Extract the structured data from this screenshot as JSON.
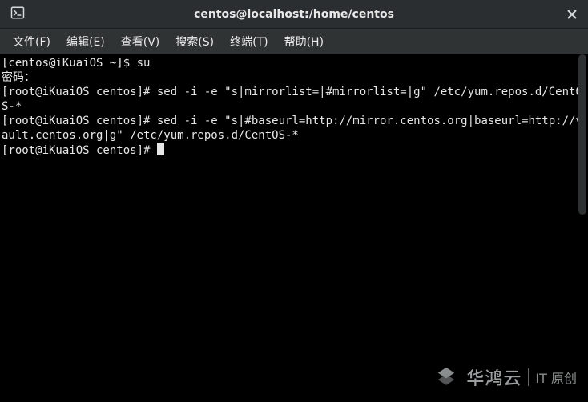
{
  "window": {
    "title": "centos@localhost:/home/centos"
  },
  "menu": {
    "file": "文件(F)",
    "edit": "编辑(E)",
    "view": "查看(V)",
    "search": "搜索(S)",
    "terminal": "终端(T)",
    "help": "帮助(H)"
  },
  "terminal": {
    "line1": "[centos@iKuaiOS ~]$ su",
    "line2": "密码：",
    "line3": "[root@iKuaiOS centos]# sed -i -e \"s|mirrorlist=|#mirrorlist=|g\" /etc/yum.repos.d/CentOS-*",
    "line4": "[root@iKuaiOS centos]# sed -i -e \"s|#baseurl=http://mirror.centos.org|baseurl=http://vault.centos.org|g\" /etc/yum.repos.d/CentOS-*",
    "line5_prompt": "[root@iKuaiOS centos]# "
  },
  "watermark": {
    "brand": "华鸿云",
    "sub": "IT 原创"
  }
}
